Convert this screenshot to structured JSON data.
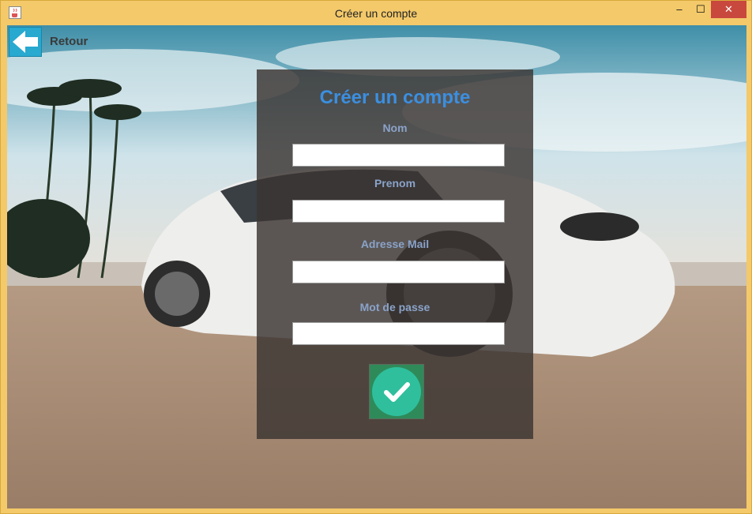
{
  "window": {
    "title": "Créer un compte",
    "controls": {
      "minimize": "–",
      "maximize": "☐",
      "close": "✕"
    }
  },
  "nav": {
    "back_label": "Retour"
  },
  "form": {
    "title": "Créer un compte",
    "fields": [
      {
        "label": "Nom",
        "value": ""
      },
      {
        "label": "Prenom",
        "value": ""
      },
      {
        "label": "Adresse Mail",
        "value": ""
      },
      {
        "label": "Mot de passe",
        "value": ""
      }
    ]
  },
  "colors": {
    "title_accent": "#3b8fe0",
    "label": "#8aa3c9",
    "back_button": "#27a9d0",
    "submit_circle": "#2fbf9d",
    "titlebar": "#f3c96a"
  },
  "icons": {
    "app": "java-cup-icon",
    "back": "arrow-left-icon",
    "submit": "checkmark-icon"
  }
}
